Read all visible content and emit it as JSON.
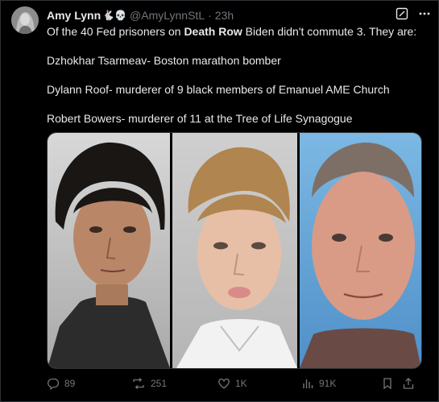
{
  "post": {
    "display_name": "Amy Lynn",
    "name_emojis": "🐇💀",
    "handle": "@AmyLynnStL",
    "separator": "·",
    "time": "23h",
    "text_line1_pre": "Of the 40 Fed prisoners on ",
    "text_line1_bold": "Death Row",
    "text_line1_post": " Biden didn't commute 3. They are:",
    "text_line2": "Dzhokhar Tsarmeav- Boston marathon bomber",
    "text_line3": "Dylann Roof- murderer of 9 black members of Emanuel AME Church",
    "text_line4": "Robert Bowers- murderer of 11 at the Tree of Life Synagogue"
  },
  "actions": {
    "replies": "89",
    "reposts": "251",
    "likes": "1K",
    "views": "91K"
  },
  "colors": {
    "background": "#000000",
    "text": "#e7e9ea",
    "secondary": "#71767b",
    "border": "#2f3336"
  },
  "icons": [
    "grok-icon",
    "more-icon",
    "reply-icon",
    "repost-icon",
    "like-icon",
    "views-icon",
    "bookmark-icon",
    "share-icon"
  ]
}
